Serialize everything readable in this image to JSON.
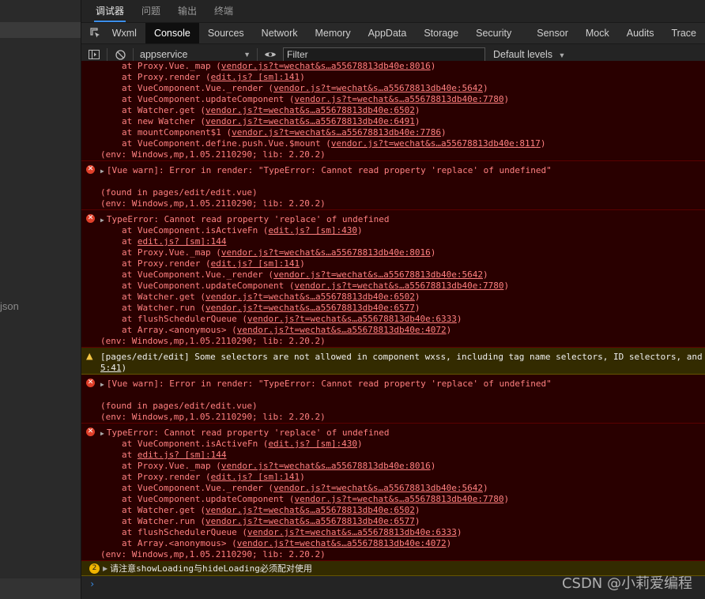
{
  "left": {
    "file_label": "json"
  },
  "top_tabs": [
    "调试器",
    "问题",
    "输出",
    "终端"
  ],
  "panel_tabs": [
    "Wxml",
    "Console",
    "Sources",
    "Network",
    "Memory",
    "AppData",
    "Storage",
    "Security",
    "Sensor",
    "Mock",
    "Audits",
    "Trace"
  ],
  "toolbar": {
    "context": "appservice",
    "filter_placeholder": "Filter",
    "levels": "Default levels"
  },
  "console": {
    "block1": {
      "lines": [
        {
          "pre": "at Proxy.Vue._map (",
          "link": "vendor.js?t=wechat&s…a55678813db40e:8016",
          "post": ")"
        },
        {
          "pre": "at Proxy.render (",
          "link": "edit.js? [sm]:141",
          "post": ")"
        },
        {
          "pre": "at VueComponent.Vue._render (",
          "link": "vendor.js?t=wechat&s…a55678813db40e:5642",
          "post": ")"
        },
        {
          "pre": "at VueComponent.updateComponent (",
          "link": "vendor.js?t=wechat&s…a55678813db40e:7780",
          "post": ")"
        },
        {
          "pre": "at Watcher.get (",
          "link": "vendor.js?t=wechat&s…a55678813db40e:6502",
          "post": ")"
        },
        {
          "pre": "at new Watcher (",
          "link": "vendor.js?t=wechat&s…a55678813db40e:6491",
          "post": ")"
        },
        {
          "pre": "at mountComponent$1 (",
          "link": "vendor.js?t=wechat&s…a55678813db40e:7786",
          "post": ")"
        },
        {
          "pre": "at VueComponent.define.push.Vue.$mount (",
          "link": "vendor.js?t=wechat&s…a55678813db40e:8117",
          "post": ")"
        }
      ],
      "env": "(env: Windows,mp,1.05.2110290; lib: 2.20.2)"
    },
    "vue_warn_1": {
      "head": "[Vue warn]: Error in render: \"TypeError: Cannot read property 'replace' of undefined\"",
      "found": "(found in pages/edit/edit.vue)",
      "env": "(env: Windows,mp,1.05.2110290; lib: 2.20.2)"
    },
    "type_error_1": {
      "head": "TypeError: Cannot read property 'replace' of undefined",
      "lines": [
        {
          "pre": "at VueComponent.isActiveFn (",
          "link": "edit.js? [sm]:430",
          "post": ")"
        },
        {
          "pre": "at ",
          "link": "edit.js? [sm]:144",
          "post": ""
        },
        {
          "pre": "at Proxy.Vue._map (",
          "link": "vendor.js?t=wechat&s…a55678813db40e:8016",
          "post": ")"
        },
        {
          "pre": "at Proxy.render (",
          "link": "edit.js? [sm]:141",
          "post": ")"
        },
        {
          "pre": "at VueComponent.Vue._render (",
          "link": "vendor.js?t=wechat&s…a55678813db40e:5642",
          "post": ")"
        },
        {
          "pre": "at VueComponent.updateComponent (",
          "link": "vendor.js?t=wechat&s…a55678813db40e:7780",
          "post": ")"
        },
        {
          "pre": "at Watcher.get (",
          "link": "vendor.js?t=wechat&s…a55678813db40e:6502",
          "post": ")"
        },
        {
          "pre": "at Watcher.run (",
          "link": "vendor.js?t=wechat&s…a55678813db40e:6577",
          "post": ")"
        },
        {
          "pre": "at flushSchedulerQueue (",
          "link": "vendor.js?t=wechat&s…a55678813db40e:6333",
          "post": ")"
        },
        {
          "pre": "at Array.<anonymous> (",
          "link": "vendor.js?t=wechat&s…a55678813db40e:4072",
          "post": ")"
        }
      ],
      "env": "(env: Windows,mp,1.05.2110290; lib: 2.20.2)"
    },
    "wxss_warning": {
      "line1": "[pages/edit/edit] Some selectors are not allowed in component wxss, including tag name selectors, ID selectors, and",
      "line2_link": "5:41",
      "line2_post": ")"
    },
    "vue_warn_2": {
      "head": "[Vue warn]: Error in render: \"TypeError: Cannot read property 'replace' of undefined\"",
      "found": "(found in pages/edit/edit.vue)",
      "env": "(env: Windows,mp,1.05.2110290; lib: 2.20.2)"
    },
    "type_error_2": {
      "head": "TypeError: Cannot read property 'replace' of undefined",
      "lines": [
        {
          "pre": "at VueComponent.isActiveFn (",
          "link": "edit.js? [sm]:430",
          "post": ")"
        },
        {
          "pre": "at ",
          "link": "edit.js? [sm]:144",
          "post": ""
        },
        {
          "pre": "at Proxy.Vue._map (",
          "link": "vendor.js?t=wechat&s…a55678813db40e:8016",
          "post": ")"
        },
        {
          "pre": "at Proxy.render (",
          "link": "edit.js? [sm]:141",
          "post": ")"
        },
        {
          "pre": "at VueComponent.Vue._render (",
          "link": "vendor.js?t=wechat&s…a55678813db40e:5642",
          "post": ")"
        },
        {
          "pre": "at VueComponent.updateComponent (",
          "link": "vendor.js?t=wechat&s…a55678813db40e:7780",
          "post": ")"
        },
        {
          "pre": "at Watcher.get (",
          "link": "vendor.js?t=wechat&s…a55678813db40e:6502",
          "post": ")"
        },
        {
          "pre": "at Watcher.run (",
          "link": "vendor.js?t=wechat&s…a55678813db40e:6577",
          "post": ")"
        },
        {
          "pre": "at flushSchedulerQueue (",
          "link": "vendor.js?t=wechat&s…a55678813db40e:6333",
          "post": ")"
        },
        {
          "pre": "at Array.<anonymous> (",
          "link": "vendor.js?t=wechat&s…a55678813db40e:4072",
          "post": ")"
        }
      ],
      "env": "(env: Windows,mp,1.05.2110290; lib: 2.20.2)"
    },
    "loading_warning": {
      "count": "2",
      "text_parts": [
        "请注意 ",
        "showLoading",
        " 与 ",
        "hideLoading",
        " 必须配对使用"
      ]
    },
    "prompt": "›"
  },
  "watermark": "CSDN @小莉爱编程",
  "colors": {
    "error_bg": "#290000",
    "error_text": "#ff8080",
    "warn_bg": "#332b00",
    "accent": "#3b8eea"
  }
}
